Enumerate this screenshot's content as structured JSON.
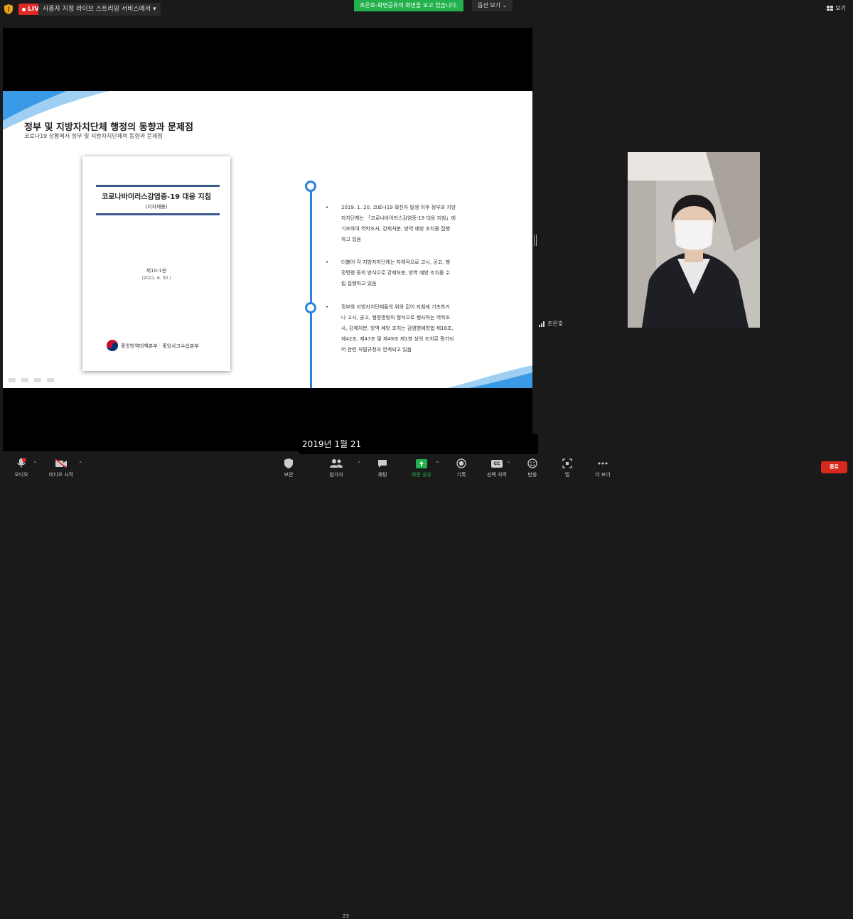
{
  "topbar": {
    "live_badge": "LIVE",
    "live_service_text": "사용자 지정 라이브 스트리밍 서비스에서",
    "live_service_caret": "▾",
    "share_banner": "조은호-화면공유의 화면을 보고 있습니다.",
    "view_options": "옵션 보기 ⌄",
    "top_right_view": "보기"
  },
  "slide": {
    "title": "정부 및 지방자치단체 행정의 동향과 문제점",
    "subtitle": "코로나19 상황에서 정부 및 지방자치단체의 동향과 문제점",
    "document": {
      "title": "코로나바이러스감염증-19 대응 지침",
      "subtitle": "(지자체용)",
      "edition": "제10-1판",
      "date": "(2021. 6. 30.)",
      "publisher": "중앙방역대책본부 · 중앙사고수습본부"
    },
    "bullets": [
      [
        "2019. 1. 20. 코로나19 확진자 발생 이후 정부와 지방",
        "자치단체는 「코로나바이러스감염증-19 대응 지침」에",
        "기초하여 역학조사, 강제처분, 방역 예방 조치를 집행",
        "하고 있음"
      ],
      [
        "더불어 각 지방자치단체는 자체적으로 고시, 공고, 행",
        "정명령 등의 방식으로 강제처분, 방역 예방 조치를 수",
        "립 집행하고 있음"
      ],
      [
        "정부와 지방자치단체들의 위와 같이 지침에 기초하거",
        "나 고시, 공고, 행정명령의 형식으로 행사하는 역학조",
        "사, 강제처분, 방역 예방 조치는 감염병예방법 제18조,",
        "제42조, 제47조 및 제49조 제1항 상의 조치로 평가되",
        "어 관련 처벌규정과 연계되고 있음"
      ]
    ]
  },
  "caption": "2019년 1월 21",
  "participant": {
    "name": "조은호"
  },
  "toolbar": {
    "audio": "오디오",
    "video": "비디오 시작",
    "security": "보안",
    "participants": "참가자",
    "participants_count": "23",
    "chat": "채팅",
    "share": "화면 공유",
    "record": "기록",
    "cc_icon": "CC",
    "captions": "선택 자막",
    "reactions": "반응",
    "apps": "앱",
    "more": "더 보기",
    "end": "종료"
  },
  "icons": [
    "shield-icon",
    "microphone-icon",
    "video-off-icon",
    "security-shield-icon",
    "participants-icon",
    "chat-icon",
    "share-screen-icon",
    "record-icon",
    "closed-caption-icon",
    "reactions-icon",
    "apps-icon",
    "more-icon",
    "signal-icon",
    "view-grid-icon"
  ],
  "colors": {
    "live": "#e02828",
    "share_banner": "#23b14d",
    "share_button": "#23b14d",
    "end_button": "#d7291c",
    "timeline": "#2b82e0"
  }
}
